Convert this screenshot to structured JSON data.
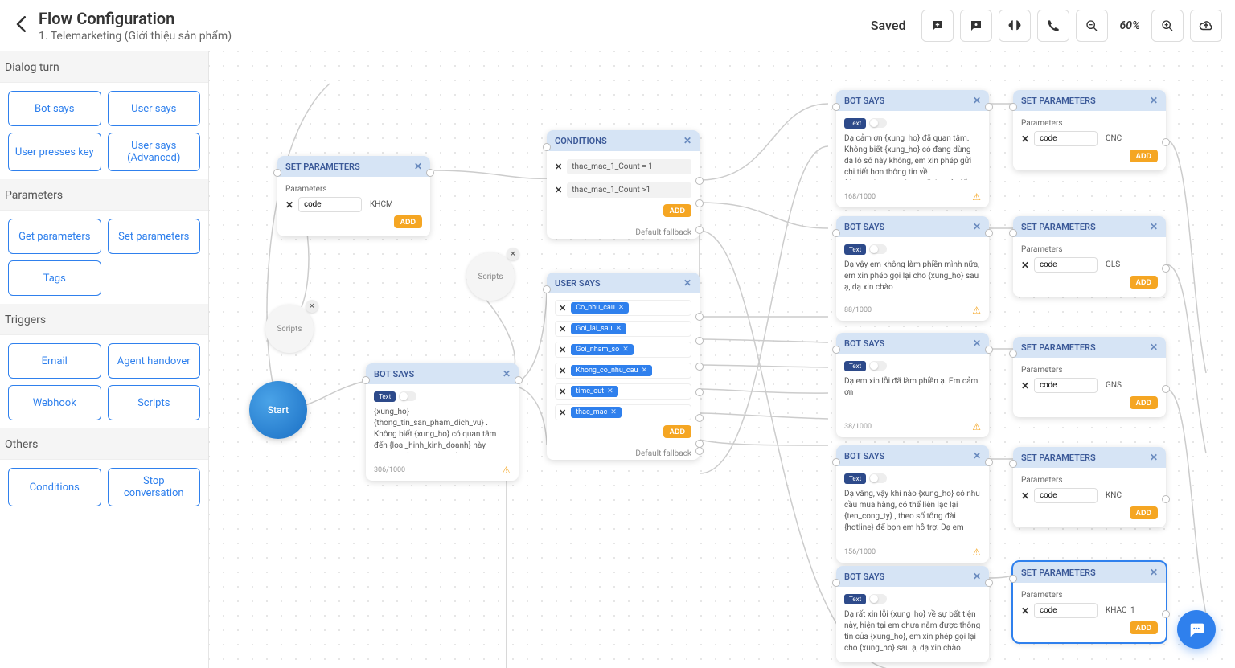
{
  "header": {
    "title": "Flow Configuration",
    "subtitle": "1. Telemarketing (Giới thiệu sản phẩm)",
    "saved": "Saved",
    "zoom": "60%"
  },
  "sidebar": {
    "sections": [
      {
        "title": "Dialog turn",
        "items": [
          "Bot says",
          "User says",
          "User presses key",
          "User says (Advanced)"
        ]
      },
      {
        "title": "Parameters",
        "items": [
          "Get parameters",
          "Set parameters",
          "Tags"
        ]
      },
      {
        "title": "Triggers",
        "items": [
          "Email",
          "Agent handover",
          "Webhook",
          "Scripts"
        ]
      },
      {
        "title": "Others",
        "items": [
          "Conditions",
          "Stop conversation"
        ]
      }
    ]
  },
  "nodes": {
    "start": {
      "label": "Start"
    },
    "scripts1": {
      "label": "Scripts"
    },
    "scripts2": {
      "label": "Scripts"
    },
    "setParams0": {
      "title": "SET PARAMETERS",
      "param_label": "Parameters",
      "rows": [
        {
          "key": "code",
          "value": "KHCM"
        }
      ],
      "add": "ADD"
    },
    "botSays1": {
      "title": "BOT SAYS",
      "badge": "Text",
      "text": "{xung_ho} {thong_tin_san_pham_dich_vu} . Không biết {xung_ho} có quan tâm đến {loai_hinh_kinh_doanh} này không, để bên em tư vấn thêm cho mình ạ.",
      "counter": "306/1000"
    },
    "conditions": {
      "title": "CONDITIONS",
      "rows": [
        "thac_mac_1_Count = 1",
        "thac_mac_1_Count >1"
      ],
      "add": "ADD",
      "fallback": "Default fallback"
    },
    "userSays": {
      "title": "USER SAYS",
      "chips": [
        "Co_nhu_cau",
        "Goi_lai_sau",
        "Goi_nham_so",
        "Khong_co_nhu_cau",
        "time_out",
        "thac_mac"
      ],
      "add": "ADD",
      "fallback": "Default fallback"
    },
    "botSaysA": {
      "title": "BOT SAYS",
      "badge": "Text",
      "text": "Dạ cảm ơn {xung_ho} đã quan tâm. Không biết {xung_ho} có đang dùng da lô số này không, em xin phép gửi chi tiết hơn thông tin về {thong_tin_san_pham_dich_vu}, để",
      "counter": "168/1000"
    },
    "botSaysB": {
      "title": "BOT SAYS",
      "badge": "Text",
      "text": "Dạ vậy em không làm phiền mình nữa, em xin phép gọi lại cho {xung_ho} sau ạ, dạ xin chào",
      "counter": "88/1000"
    },
    "botSaysC": {
      "title": "BOT SAYS",
      "badge": "Text",
      "text": "Dạ em xin lỗi đã làm phiền ạ. Em cảm ơn",
      "counter": "38/1000"
    },
    "botSaysD": {
      "title": "BOT SAYS",
      "badge": "Text",
      "text": "Dạ vâng, vậy khi nào {xung_ho} có nhu cầu mua hàng, có thể liên lạc lại {ten_cong_ty} , theo số tổng đài {hotline} để bọn em hỗ trợ. Dạ em chào {xung_ho} ạ.",
      "counter": "156/1000"
    },
    "botSaysE": {
      "title": "BOT SAYS",
      "badge": "Text",
      "text": "Dạ rất xin lỗi {xung_ho} về sự bất tiện này, hiện tại em chưa nắm được thông tin của {xung_ho}, em xin phép gọi lại cho {xung_ho} sau ạ, dạ xin chào",
      "counter": ""
    },
    "sp1": {
      "title": "SET PARAMETERS",
      "param_label": "Parameters",
      "rows": [
        {
          "key": "code",
          "value": "CNC"
        }
      ],
      "add": "ADD"
    },
    "sp2": {
      "title": "SET PARAMETERS",
      "param_label": "Parameters",
      "rows": [
        {
          "key": "code",
          "value": "GLS"
        }
      ],
      "add": "ADD"
    },
    "sp3": {
      "title": "SET PARAMETERS",
      "param_label": "Parameters",
      "rows": [
        {
          "key": "code",
          "value": "GNS"
        }
      ],
      "add": "ADD"
    },
    "sp4": {
      "title": "SET PARAMETERS",
      "param_label": "Parameters",
      "rows": [
        {
          "key": "code",
          "value": "KNC"
        }
      ],
      "add": "ADD"
    },
    "sp5": {
      "title": "SET PARAMETERS",
      "param_label": "Parameters",
      "rows": [
        {
          "key": "code",
          "value": "KHAC_1"
        }
      ],
      "add": "ADD"
    }
  }
}
